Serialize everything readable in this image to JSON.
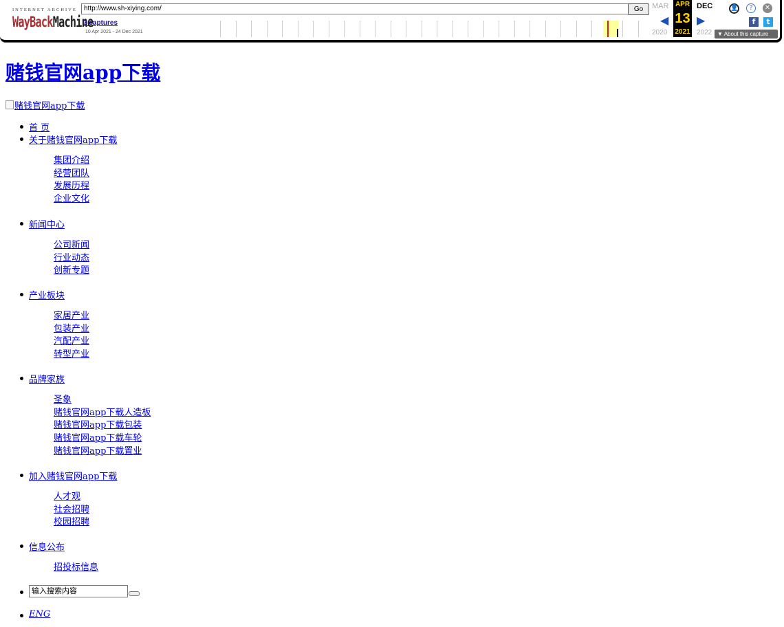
{
  "wayback": {
    "logo_top": "INTERNET ARCHIVE",
    "logo_way": "WayBack",
    "logo_machine": "Machine",
    "url": "http://www.sh-xiying.com/",
    "go_label": "Go",
    "captures": "3 captures",
    "range": "10 Apr 2021 - 24 Dec 2021",
    "months": {
      "prev": "MAR",
      "current": "APR",
      "next": "DEC"
    },
    "day": "13",
    "years": {
      "prev": "2020",
      "current": "2021",
      "next": "2022"
    },
    "about": "About this capture",
    "prev_arrow": "◀",
    "next_arrow": "▶",
    "icons": {
      "user": "👤",
      "help": "?",
      "close": "✕",
      "facebook": "f",
      "twitter": "t"
    },
    "accent_color": "#ffd200"
  },
  "site": {
    "title": "赌钱官网app下载",
    "logo_alt": "赌钱官网app下载"
  },
  "nav": {
    "home": "首 页",
    "about": "关于赌钱官网app下载",
    "about_sub": [
      "集团介绍",
      "经营团队",
      "发展历程",
      "企业文化"
    ],
    "news": "新闻中心",
    "news_sub": [
      "公司新闻",
      "行业动态",
      "创新专题"
    ],
    "industry": "产业板块",
    "industry_sub": [
      "家居产业",
      "包装产业",
      "汽配产业",
      "转型产业"
    ],
    "brands": "品牌家族",
    "brands_sub": [
      "圣象",
      "赌钱官网app下载人造板",
      "赌钱官网app下载包装",
      "赌钱官网app下载车轮",
      "赌钱官网app下载置业"
    ],
    "join": "加入赌钱官网app下载",
    "join_sub": [
      "人才观",
      "社会招聘",
      "校园招聘"
    ],
    "info": "信息公布",
    "info_sub": [
      "招投标信息"
    ],
    "search_placeholder": "输入搜索内容",
    "eng": "ENG"
  }
}
